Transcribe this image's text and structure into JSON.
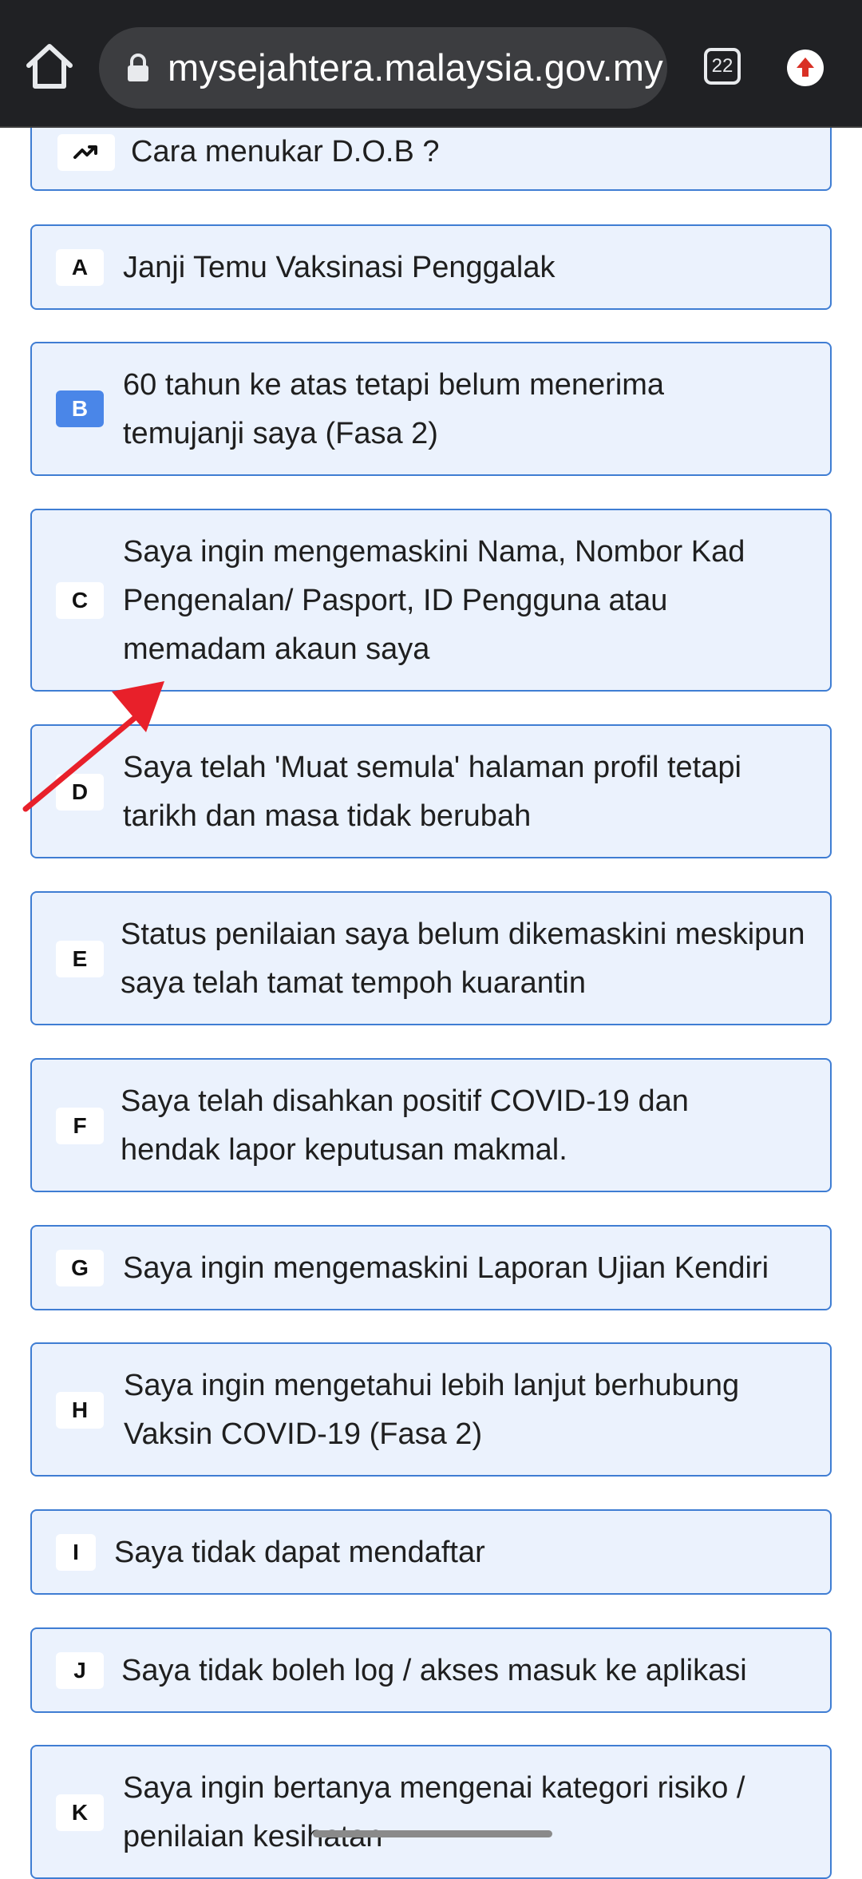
{
  "browser": {
    "url": "mysejahtera.malaysia.gov.my",
    "tab_count": "22",
    "home_icon": "home-icon",
    "lock_icon": "lock-icon",
    "update_icon": "update-arrow-icon"
  },
  "colors": {
    "item_background": "#ebf2fd",
    "item_border": "#3f7dd3",
    "active_badge": "#4a86e8",
    "annotation_arrow": "#e8202a"
  },
  "faq": {
    "trend_icon": "trending-up-icon",
    "items": [
      {
        "badge": "",
        "text": "Cara menukar D.O.B ?"
      },
      {
        "badge": "A",
        "text": "Janji Temu Vaksinasi Penggalak"
      },
      {
        "badge": "B",
        "text": "60 tahun ke atas tetapi belum menerima temujanji saya (Fasa 2)"
      },
      {
        "badge": "C",
        "text": "Saya ingin mengemaskini Nama, Nombor Kad Pengenalan/ Pasport, ID Pengguna atau memadam akaun saya"
      },
      {
        "badge": "D",
        "text": "Saya telah 'Muat semula' halaman profil tetapi tarikh dan masa tidak berubah"
      },
      {
        "badge": "E",
        "text": "Status penilaian saya belum dikemaskini meskipun saya telah tamat tempoh kuarantin"
      },
      {
        "badge": "F",
        "text": "Saya telah disahkan positif COVID-19 dan hendak lapor keputusan makmal."
      },
      {
        "badge": "G",
        "text": "Saya ingin mengemaskini Laporan Ujian Kendiri"
      },
      {
        "badge": "H",
        "text": "Saya ingin mengetahui lebih lanjut berhubung Vaksin COVID-19 (Fasa 2)"
      },
      {
        "badge": "I",
        "text": "Saya tidak dapat mendaftar"
      },
      {
        "badge": "J",
        "text": "Saya tidak boleh log / akses masuk ke aplikasi"
      },
      {
        "badge": "K",
        "text": "Saya ingin bertanya mengenai kategori risiko / penilaian kesihatan"
      }
    ]
  }
}
